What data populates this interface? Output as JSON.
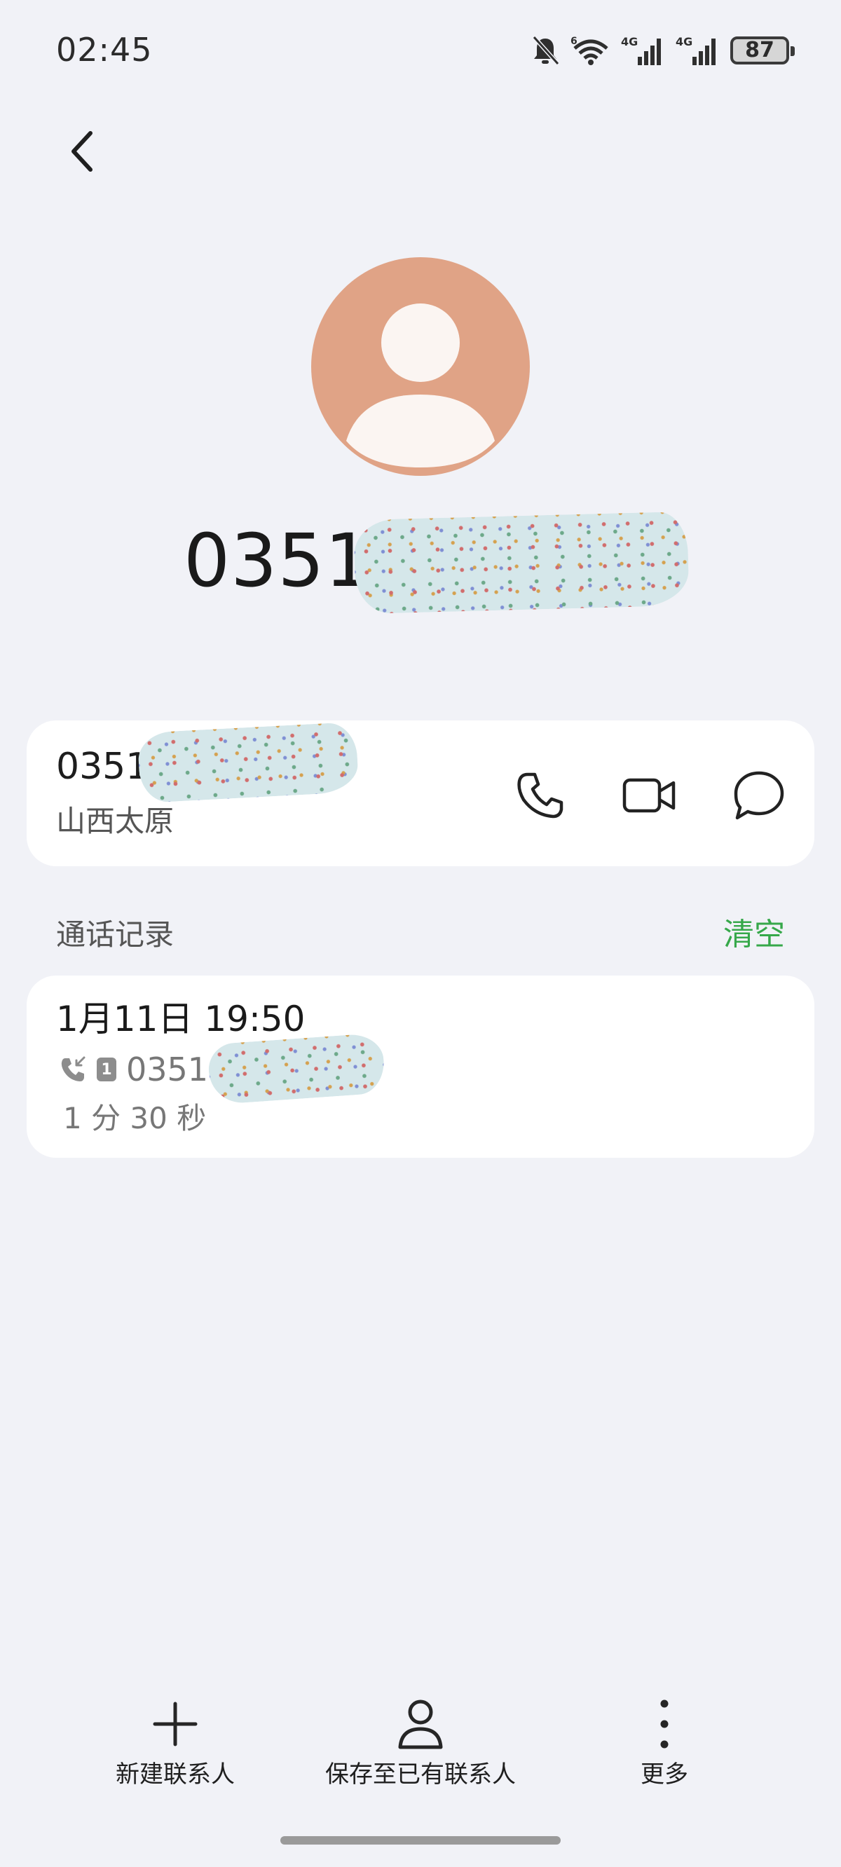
{
  "status_bar": {
    "time": "02:45",
    "battery": "87",
    "icons": [
      "mute-bell-icon",
      "wifi-icon",
      "4g-signal-icon",
      "4g-signal-icon",
      "battery-icon"
    ]
  },
  "header": {
    "back_icon": "back-arrow-icon",
    "avatar_icon": "person-avatar-icon",
    "number_prefix": "0351"
  },
  "contact_card": {
    "number_prefix": "0351",
    "location": "山西太原",
    "actions": [
      "phone-icon",
      "video-icon",
      "message-icon"
    ]
  },
  "call_log": {
    "section_title": "通话记录",
    "clear_label": "清空",
    "entries": [
      {
        "datetime": "1月11日 19:50",
        "call_type_icon": "incoming-call-icon",
        "sim": "1",
        "number_prefix": "0351",
        "duration": "1 分 30 秒"
      }
    ]
  },
  "bottom_bar": {
    "new_contact": "新建联系人",
    "save_to_existing": "保存至已有联系人",
    "more": "更多"
  },
  "colors": {
    "background": "#f1f2f7",
    "card": "#ffffff",
    "avatar": "#e0a386",
    "accent_green": "#36a84a"
  }
}
